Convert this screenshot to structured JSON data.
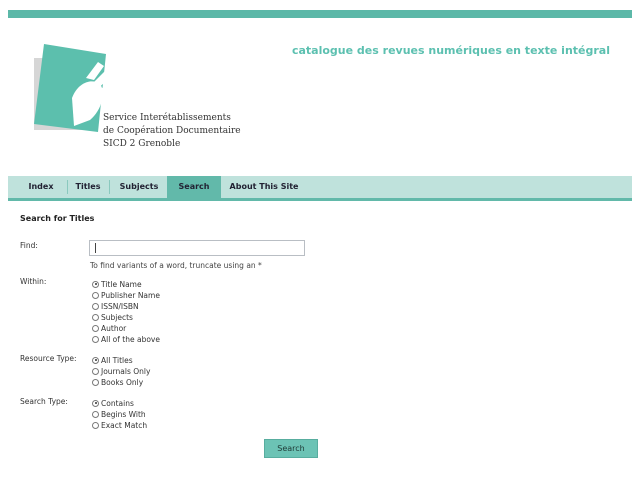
{
  "header": {
    "site_title": "catalogue des revues numériques en texte intégral",
    "org_lines": [
      "Service Interétablissements",
      "de Coopération Documentaire",
      "SICD 2 Grenoble"
    ],
    "logo_icon": "hand-on-page-logo-icon",
    "accent_color": "#5cb8a8"
  },
  "nav": {
    "items": [
      {
        "label": "Index"
      },
      {
        "label": "Titles"
      },
      {
        "label": "Subjects"
      },
      {
        "label": "Search"
      },
      {
        "label": "About This Site"
      }
    ],
    "active": "Search"
  },
  "form": {
    "title": "Search for Titles",
    "find_label": "Find:",
    "find_value": "",
    "hint": "To find variants of a word, truncate using an *",
    "within_label": "Within:",
    "within_options": [
      "Title Name",
      "Publisher Name",
      "ISSN/ISBN",
      "Subjects",
      "Author",
      "All of the above"
    ],
    "within_selected": "Title Name",
    "resource_label": "Resource Type:",
    "resource_options": [
      "All Titles",
      "Journals Only",
      "Books Only"
    ],
    "resource_selected": "All Titles",
    "type_label": "Search Type:",
    "type_options": [
      "Contains",
      "Begins With",
      "Exact Match"
    ],
    "type_selected": "Contains",
    "submit_label": "Search"
  }
}
